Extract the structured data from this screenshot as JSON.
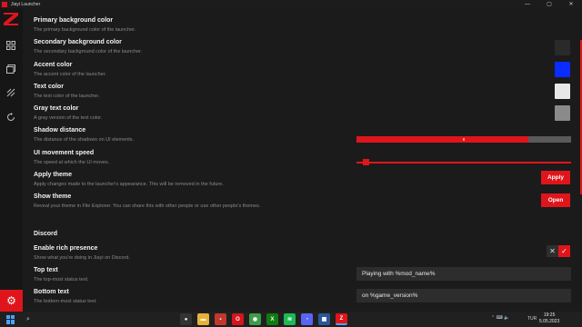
{
  "window": {
    "title": "Jiayi Launcher",
    "controls": [
      "—",
      "▢",
      "✕"
    ]
  },
  "sidebar": {
    "items": [
      {
        "icon": "grid-icon"
      },
      {
        "icon": "cards-icon"
      },
      {
        "icon": "brush-icon"
      },
      {
        "icon": "refresh-icon"
      }
    ],
    "active_item": {
      "icon": "gear-icon",
      "glyph": "⚙"
    }
  },
  "settings": {
    "primary_bg": {
      "label": "Primary background color",
      "desc": "The primary background color of the launcher.",
      "color": "#1b1b1b"
    },
    "secondary_bg": {
      "label": "Secondary background color",
      "desc": "The secondary background color of the launcher.",
      "color": "#2a2a2a"
    },
    "accent": {
      "label": "Accent color",
      "desc": "The accent color of the launcher.",
      "color": "#0a2cff"
    },
    "text_color": {
      "label": "Text color",
      "desc": "The text color of the launcher.",
      "color": "#e8e8e8"
    },
    "gray_text": {
      "label": "Gray text color",
      "desc": "A gray version of the text color.",
      "color": "#8a8a8a"
    },
    "shadow_distance": {
      "label": "Shadow distance",
      "desc": "The distance of the shadows on UI elements.",
      "value": "8",
      "fraction": 0.8
    },
    "ui_speed": {
      "label": "UI movement speed",
      "desc": "The speed at which the UI moves.",
      "fraction": 0.03
    },
    "apply_theme": {
      "label": "Apply theme",
      "desc": "Apply changes made to the launcher's appearance. This will be removed in the future.",
      "button": "Apply"
    },
    "show_theme": {
      "label": "Show theme",
      "desc": "Reveal your theme in File Explorer. You can share this with other people or use other people's themes.",
      "button": "Open"
    }
  },
  "discord": {
    "heading": "Discord",
    "rich_presence": {
      "label": "Enable rich presence",
      "desc": "Show what you're doing in Jiayi on Discord.",
      "off_glyph": "✕",
      "on_glyph": "✓"
    },
    "top_text": {
      "label": "Top text",
      "desc": "The top-most status text.",
      "value": "Playing with %mod_name%"
    },
    "bottom_text": {
      "label": "Bottom text",
      "desc": "The bottom-most status text.",
      "value": "on %game_version%"
    }
  },
  "taskbar": {
    "search_glyph": "⌕",
    "apps": [
      {
        "name": "obs-icon",
        "color": "#333333",
        "glyph": "●"
      },
      {
        "name": "folder-icon",
        "color": "#e8b23a",
        "glyph": "▬"
      },
      {
        "name": "document-icon",
        "color": "#c0392b",
        "glyph": "▪"
      },
      {
        "name": "opera-icon",
        "color": "#d7141a",
        "glyph": "O"
      },
      {
        "name": "chrome-icon",
        "color": "#3f9b48",
        "glyph": "◉"
      },
      {
        "name": "xbox-icon",
        "color": "#107c10",
        "glyph": "X"
      },
      {
        "name": "spotify-icon",
        "color": "#1db954",
        "glyph": "≋"
      },
      {
        "name": "discord-icon",
        "color": "#5865f2",
        "glyph": "◔"
      },
      {
        "name": "store-icon",
        "color": "#2b5797",
        "glyph": "▦"
      },
      {
        "name": "jiayi-icon",
        "color": "#e0151b",
        "glyph": "Z"
      }
    ],
    "tray": "⌃  ⌨  🔈",
    "language": "TUR",
    "time": "19:25",
    "date": "5.05.2023"
  }
}
